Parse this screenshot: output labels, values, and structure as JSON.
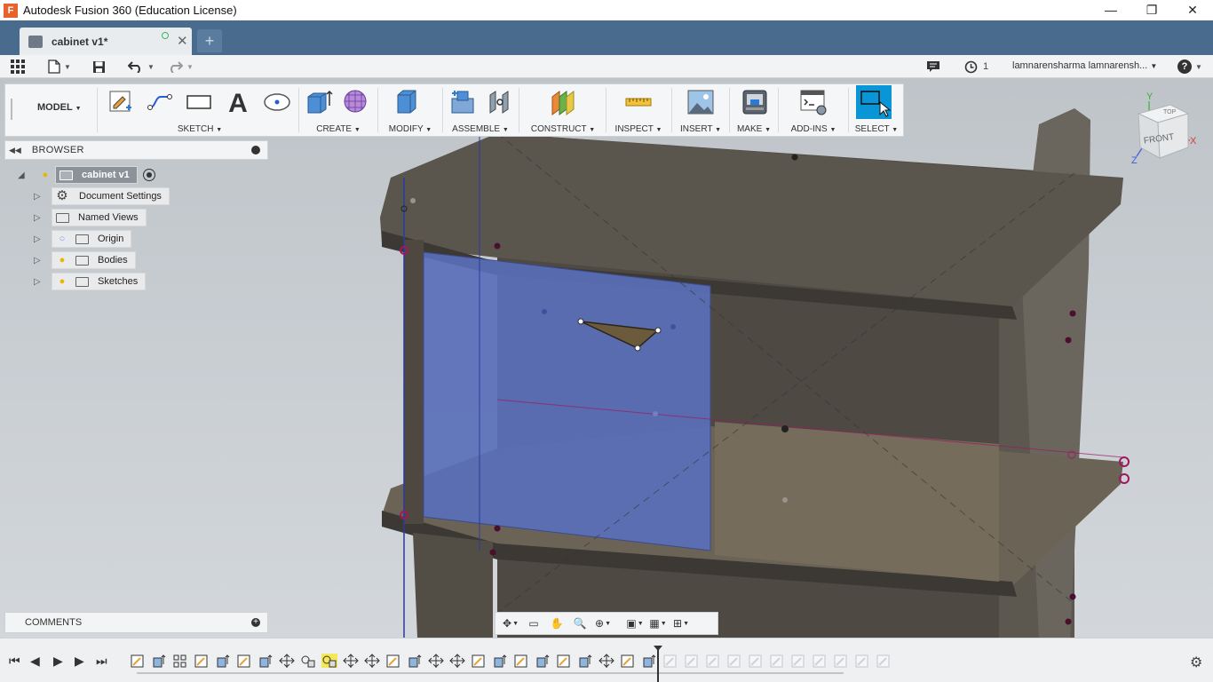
{
  "window": {
    "title": "Autodesk Fusion 360 (Education License)",
    "app_icon_letter": "F",
    "minimize": "—",
    "restore": "❐",
    "close": "✕"
  },
  "tabs": [
    {
      "label": "cabinet v1*",
      "close": "✕"
    }
  ],
  "new_tab": "+",
  "qat": {
    "job_count": "1",
    "user": "lamnarensharma lamnarensh...",
    "help": "?"
  },
  "toolbar": {
    "workspace": "MODEL",
    "groups": [
      {
        "label": "SKETCH"
      },
      {
        "label": "CREATE"
      },
      {
        "label": "MODIFY"
      },
      {
        "label": "ASSEMBLE"
      },
      {
        "label": "CONSTRUCT"
      },
      {
        "label": "INSPECT"
      },
      {
        "label": "INSERT"
      },
      {
        "label": "MAKE"
      },
      {
        "label": "ADD-INS"
      },
      {
        "label": "SELECT"
      }
    ]
  },
  "browser": {
    "header": "BROWSER",
    "root": "cabinet v1",
    "items": [
      {
        "label": "Document Settings",
        "icon": "gear-icon"
      },
      {
        "label": "Named Views",
        "icon": "folder-icon"
      },
      {
        "label": "Origin",
        "icon": "folder-icon",
        "bulb": "off"
      },
      {
        "label": "Bodies",
        "icon": "folder-icon",
        "bulb": "on"
      },
      {
        "label": "Sketches",
        "icon": "folder-icon",
        "bulb": "on"
      }
    ]
  },
  "comments": {
    "header": "COMMENTS",
    "add": "+"
  },
  "viewcube": {
    "face": "FRONT",
    "top": "TOP",
    "x": "X",
    "y": "Y",
    "z": "Z"
  },
  "colors": {
    "tabbar": "#496b8d",
    "sketch_plane": "#5a6fb8",
    "cabinet_body": "#4a463f",
    "select_active": "#0a96d6",
    "constraint_point": "#a0175e"
  }
}
